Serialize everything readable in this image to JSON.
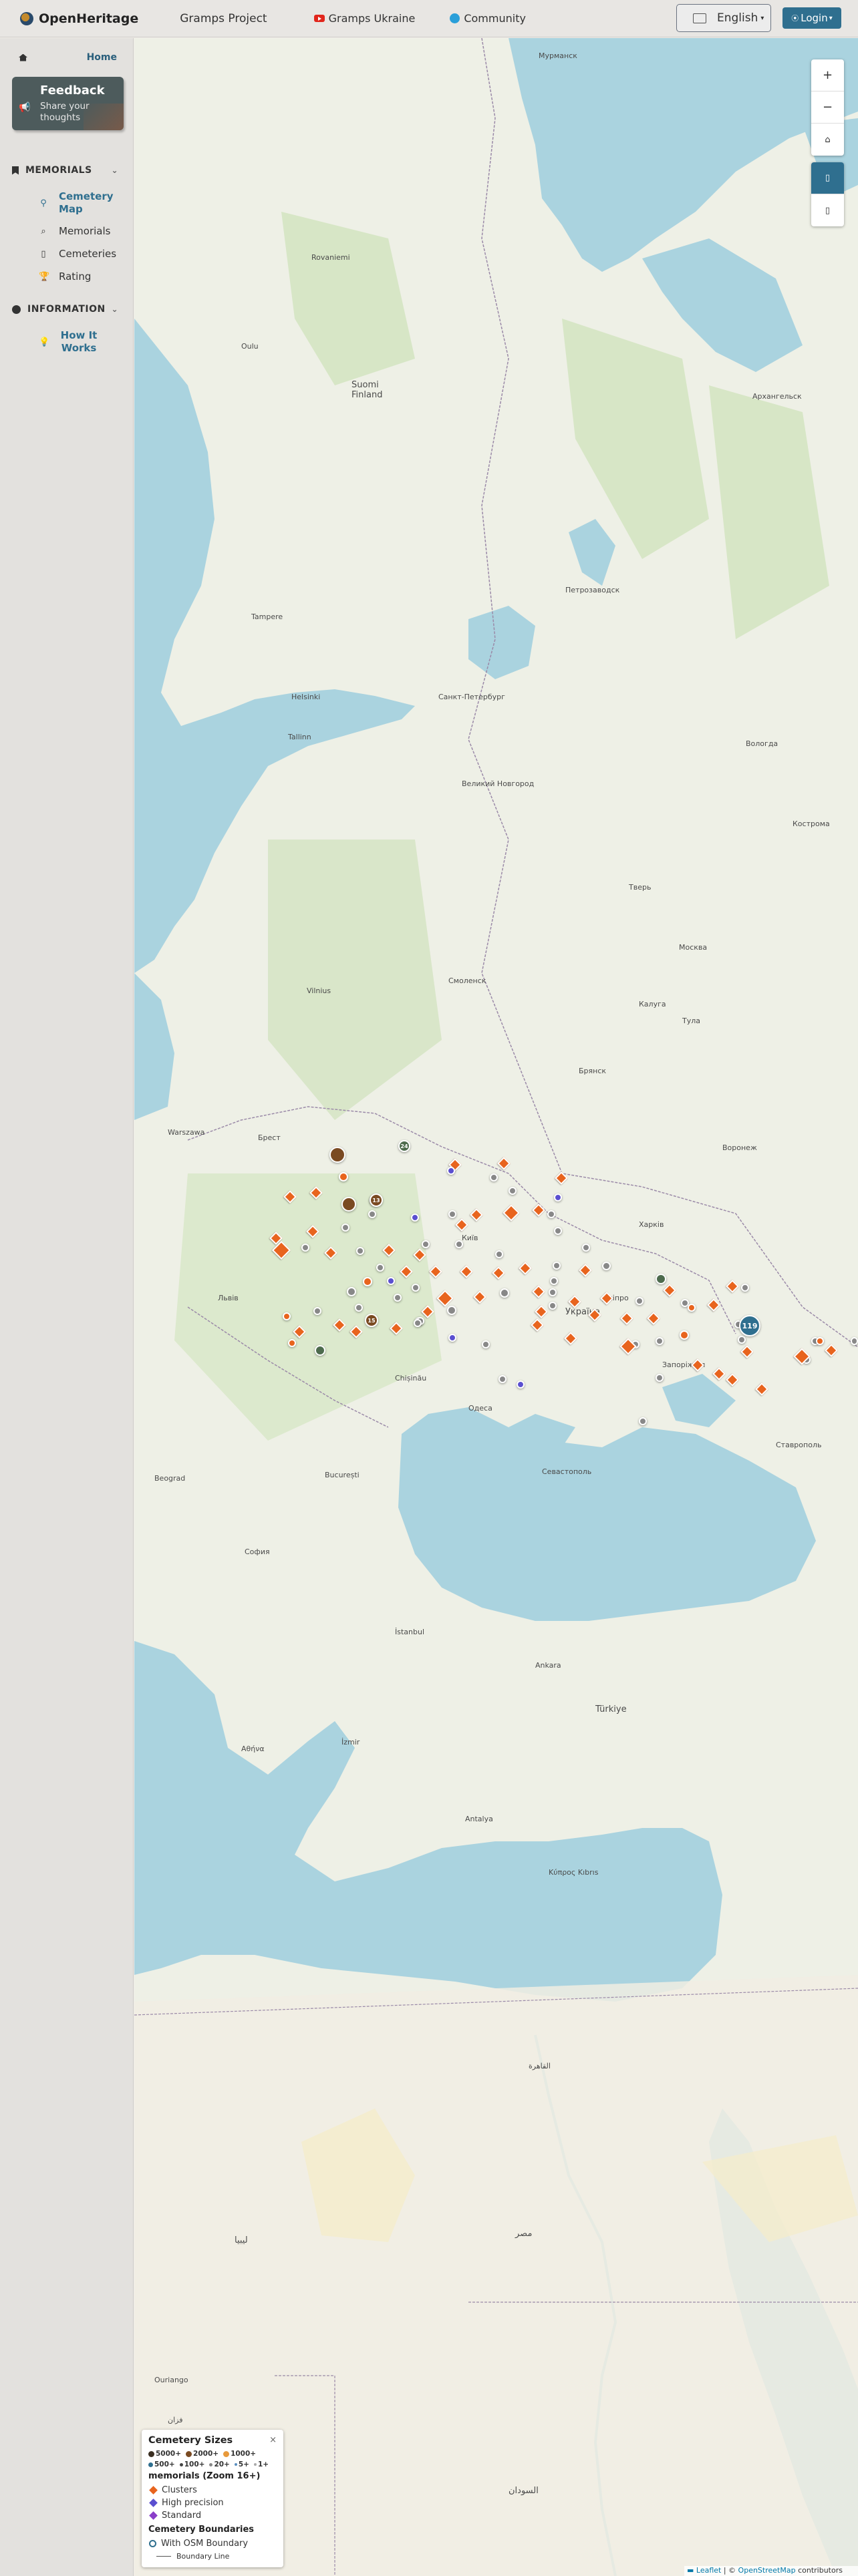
{
  "navbar": {
    "brand": "OpenHeritage",
    "projects": "Gramps Project",
    "ukraine": "Gramps Ukraine",
    "community": "Community",
    "language": "English",
    "login": "Login"
  },
  "sidebar": {
    "home": "Home",
    "feedback": {
      "title": "Feedback",
      "subtitle": "Share your thoughts"
    },
    "memorials_section": "MEMORIALS",
    "memorials_items": [
      "Cemetery Map",
      "Memorials",
      "Cemeteries",
      "Rating"
    ],
    "information_section": "INFORMATION",
    "information_items": [
      "How It Works"
    ]
  },
  "map": {
    "controls": {
      "zoom_in": "+",
      "zoom_out": "−"
    },
    "labels": {
      "murmansk": "Мурманск",
      "rovaniemi": "Rovaniemi",
      "arkhangelsk": "Архангельск",
      "oulu": "Oulu",
      "finland": "Suomi Finland",
      "petrozavodsk": "Петрозаводск",
      "tampere": "Tampere",
      "helsinki": "Helsinki",
      "spb": "Санкт-Петербург",
      "vologda": "Вологда",
      "tallinn": "Tallinn",
      "novgorod": "Великий Новгород",
      "kostroma": "Кострома",
      "tver": "Тверь",
      "moscow": "Москва",
      "vilnius": "Vilnius",
      "kaluga": "Калуга",
      "tula": "Тула",
      "smolensk": "Смоленск",
      "bryansk": "Брянск",
      "warszawa": "Warszawa",
      "brest": "Брест",
      "voronezh": "Воронеж",
      "kharkiv": "Харків",
      "kyiv": "Київ",
      "lviv": "Львів",
      "ukraine": "Україна",
      "dnipro": "Дніпро",
      "odesa": "Одеса",
      "zaporizhzhia": "Запоріжжя",
      "chisinau": "Chișinău",
      "bucuresti": "București",
      "beograd": "Beograd",
      "sofia": "София",
      "sevastopol": "Севастополь",
      "stavropol": "Ставрополь",
      "istanbul": "İstanbul",
      "ankara": "Ankara",
      "turkiye": "Türkiye",
      "athina": "Αθήνα",
      "izmir": "İzmir",
      "antalya": "Antalya",
      "kibris": "Κύπρος Kıbrıs",
      "cairo": "القاهرة",
      "misr": "مصر",
      "libya": "ليبيا",
      "sudan": "السودان",
      "ouriango": "Ouriango",
      "fezzan": "فزان"
    },
    "clusters": [
      "24",
      "13",
      "15",
      "119"
    ]
  },
  "legend": {
    "title": "Cemetery Sizes",
    "close": "×",
    "sizes": [
      "5000+",
      "2000+",
      "1000+",
      "500+",
      "100+",
      "20+",
      "5+",
      "1+"
    ],
    "memorials_title": "memorials (Zoom 16+)",
    "memorials_items": [
      "Clusters",
      "High precision",
      "Standard"
    ],
    "boundaries_title": "Cemetery Boundaries",
    "boundaries_items": [
      "With OSM Boundary",
      "Boundary Line"
    ],
    "colors": {
      "cluster": "#e8641e",
      "high_precision": "#5a4fd0",
      "standard": "#8a3fc9"
    }
  },
  "attribution": {
    "leaflet": "Leaflet",
    "sep": "| ©",
    "osm": "OpenStreetMap",
    "contrib": "contributors"
  }
}
